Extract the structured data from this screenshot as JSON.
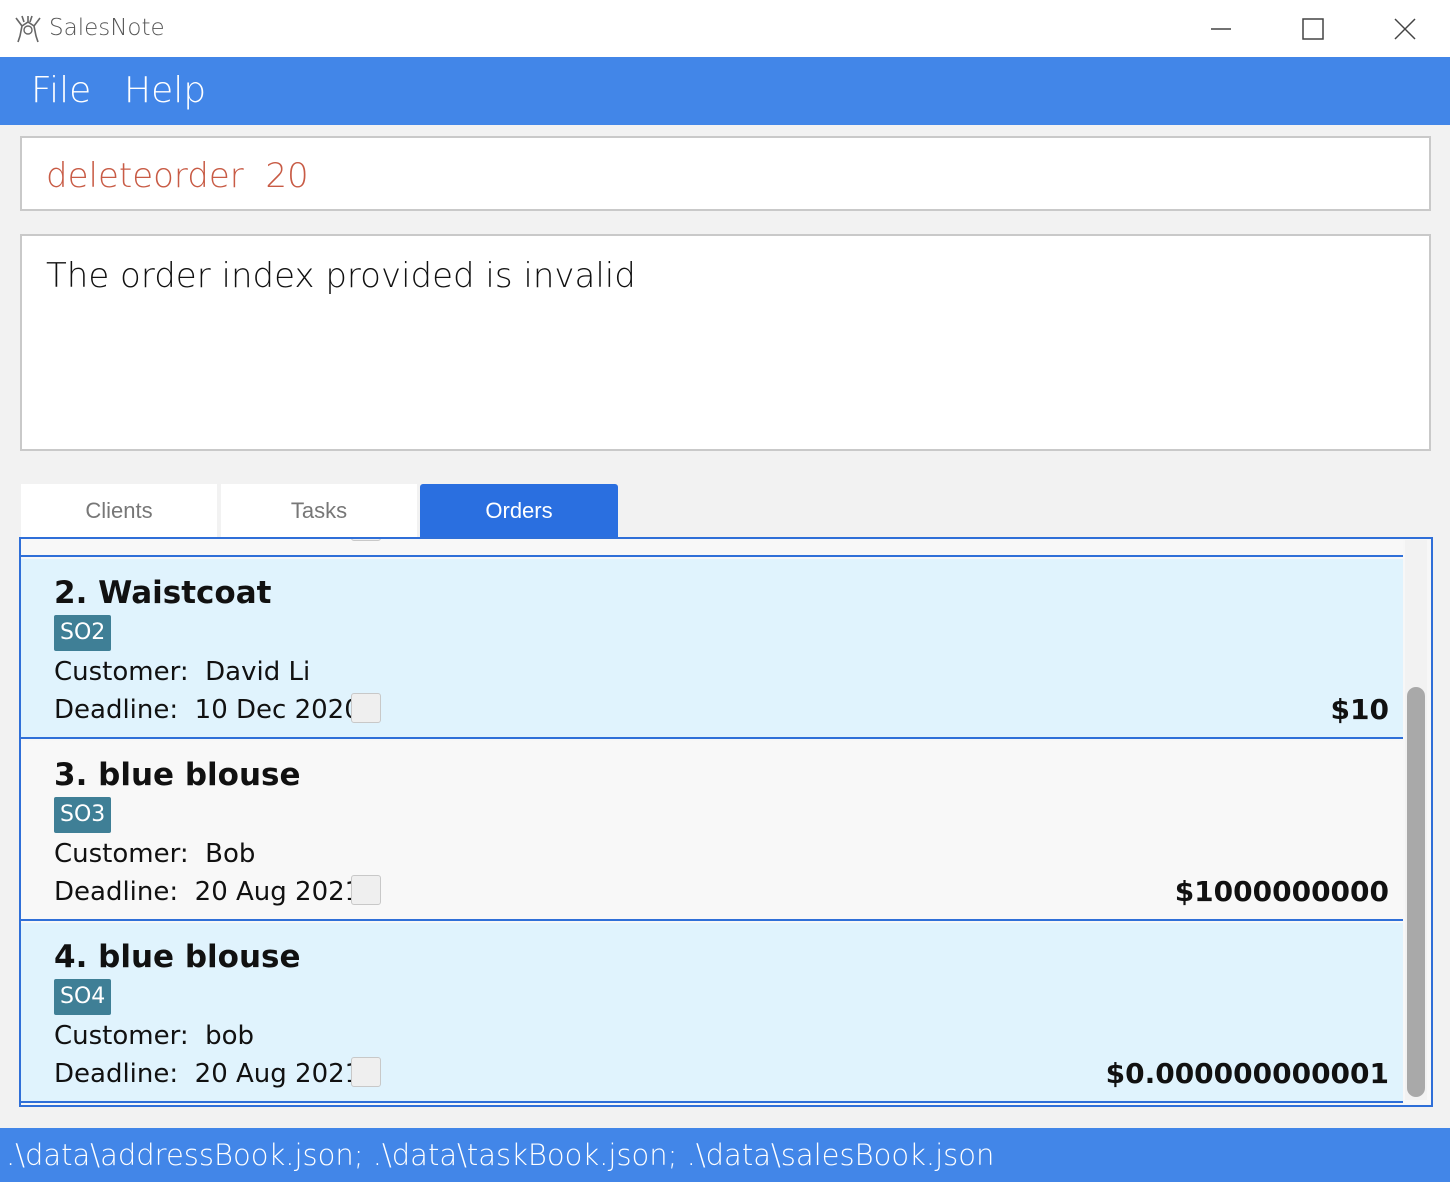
{
  "window": {
    "title": "SalesNote"
  },
  "menu": {
    "file": "File",
    "help": "Help"
  },
  "command": {
    "value": "deleteorder  20"
  },
  "result": {
    "message": "The order index provided is invalid"
  },
  "tabs": [
    {
      "label": "Clients",
      "active": false
    },
    {
      "label": "Tasks",
      "active": false
    },
    {
      "label": "Orders",
      "active": true
    }
  ],
  "orders": [
    {
      "title": "2. Waistcoat",
      "tag": "SO2",
      "customer": "Customer:  David Li",
      "deadline": "Deadline:  10 Dec 2020",
      "price": "$10",
      "done": false
    },
    {
      "title": "3. blue blouse",
      "tag": "SO3",
      "customer": "Customer:  Bob",
      "deadline": "Deadline:  20 Aug 2021",
      "price": "$1000000000",
      "done": false
    },
    {
      "title": "4. blue blouse",
      "tag": "SO4",
      "customer": "Customer:  bob",
      "deadline": "Deadline:  20 Aug 2021",
      "price": "$0.000000000001",
      "done": false
    }
  ],
  "status": {
    "path": ".\\data\\addressBook.json; .\\data\\taskBook.json; .\\data\\salesBook.json"
  },
  "colors": {
    "accent": "#4286e8",
    "active_tab": "#2a6fe0",
    "tag": "#3f7f96",
    "command_text": "#c85b45",
    "card_selected": "#e0f3fd"
  },
  "icons": [
    "app-icon",
    "minimize-icon",
    "maximize-icon",
    "close-icon"
  ]
}
